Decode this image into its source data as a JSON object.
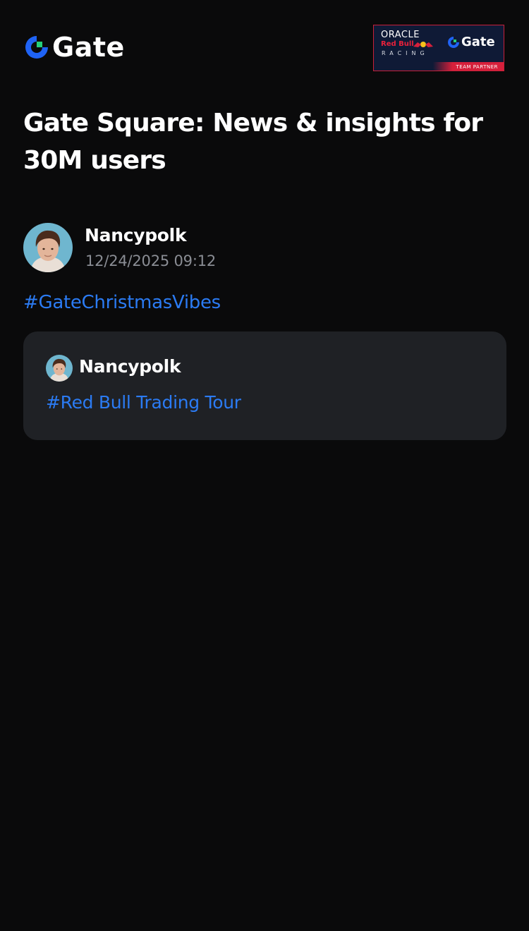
{
  "brand": {
    "name": "Gate",
    "accent": "#2b7bf3",
    "logo_blue": "#1f63f5",
    "logo_green": "#25d07b"
  },
  "partner": {
    "line1": "ORACLE",
    "line2": "Red Bull",
    "line3": "RACING",
    "gate_label": "Gate",
    "strip_label": "TEAM PARTNER",
    "colors": {
      "navy": "#0f1a36",
      "red": "#d6203b"
    }
  },
  "page": {
    "title": "Gate Square: News & insights for 30M users",
    "background": "#0a0a0b"
  },
  "post": {
    "author": "Nancypolk",
    "timestamp": "12/24/2025 09:12",
    "hashtag": "#GateChristmasVibes",
    "avatar_icon": "user-avatar-icon",
    "quote": {
      "author": "Nancypolk",
      "hashtag": "#Red Bull Trading Tour",
      "card_color": "#1f2125"
    }
  }
}
